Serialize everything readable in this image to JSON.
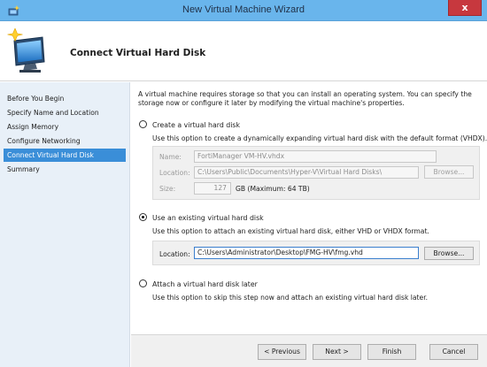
{
  "window": {
    "title": "New Virtual Machine Wizard",
    "close_label": "x"
  },
  "header": {
    "title": "Connect Virtual Hard Disk"
  },
  "nav": {
    "items": [
      {
        "label": "Before You Begin"
      },
      {
        "label": "Specify Name and Location"
      },
      {
        "label": "Assign Memory"
      },
      {
        "label": "Configure Networking"
      },
      {
        "label": "Connect Virtual Hard Disk"
      },
      {
        "label": "Summary"
      }
    ],
    "active_index": 4
  },
  "intro": {
    "line1": "A virtual machine requires storage so that you can install an operating system. You can specify the",
    "line2": "storage now or configure it later by modifying the virtual machine's properties."
  },
  "create_option": {
    "label": "Create a virtual hard disk",
    "description": "Use this option to create a dynamically expanding virtual hard disk with the default format (VHDX).",
    "name_label": "Name:",
    "name_value": "FortiManager VM-HV.vhdx",
    "location_label": "Location:",
    "location_value": "C:\\Users\\Public\\Documents\\Hyper-V\\Virtual Hard Disks\\",
    "browse_label": "Browse...",
    "size_label": "Size:",
    "size_value": "127",
    "size_unit": "GB (Maximum: 64 TB)",
    "selected": false
  },
  "existing_option": {
    "label": "Use an existing virtual hard disk",
    "description": "Use this option to attach an existing virtual hard disk, either VHD or VHDX format.",
    "location_label": "Location:",
    "location_value": "C:\\Users\\Administrator\\Desktop\\FMG-HV\\fmg.vhd",
    "browse_label": "Browse...",
    "selected": true
  },
  "later_option": {
    "label": "Attach a virtual hard disk later",
    "description": "Use this option to skip this step now and attach an existing virtual hard disk later.",
    "selected": false
  },
  "footer": {
    "previous_label": "< Previous",
    "next_label": "Next >",
    "finish_label": "Finish",
    "cancel_label": "Cancel"
  },
  "colors": {
    "titlebar": "#69b5ec",
    "nav_bg": "#e8f0f8",
    "nav_active": "#3a8ed8",
    "close_button": "#c7383e"
  }
}
